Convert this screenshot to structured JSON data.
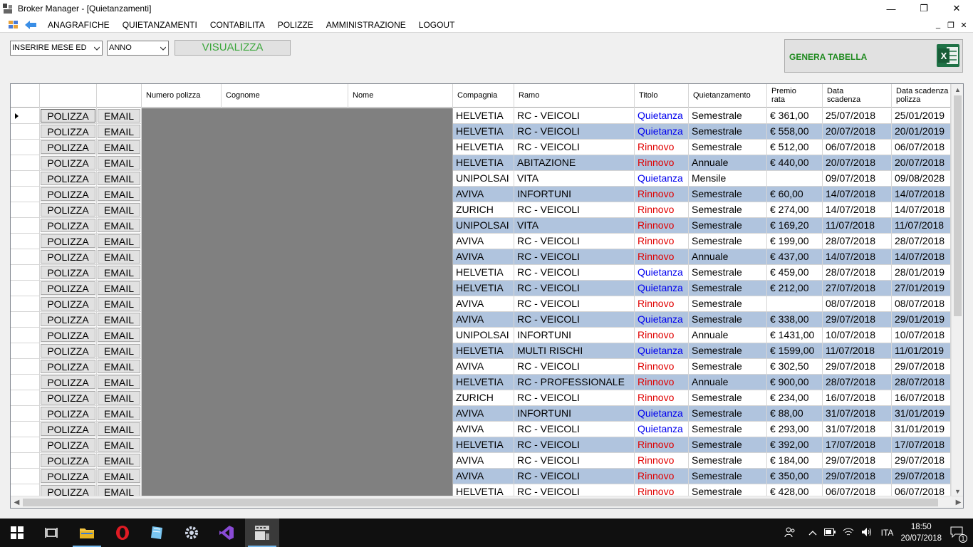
{
  "window": {
    "title": "Broker Manager - [Quietanzamenti]",
    "controls": {
      "minimize": "—",
      "maximize": "❐",
      "close": "✕"
    }
  },
  "menu": {
    "items": [
      "ANAGRAFICHE",
      "QUIETANZAMENTI",
      "CONTABILITA",
      "POLIZZE",
      "AMMINISTRAZIONE",
      "LOGOUT"
    ],
    "mdi_controls": {
      "minimize": "_",
      "restore": "❐",
      "close": "✕"
    }
  },
  "filters": {
    "month_combo": "INSERIRE MESE ED",
    "year_combo": "ANNO",
    "visualizza_label": "VISUALIZZA",
    "genera_label": "GENERA TABELLA",
    "excel_glyph": "X"
  },
  "grid": {
    "columns": {
      "numero_polizza": "Numero polizza",
      "cognome": "Cognome",
      "nome": "Nome",
      "compagnia": "Compagnia",
      "ramo": "Ramo",
      "titolo": "Titolo",
      "quietanzamento": "Quietanzamento",
      "premio_rata_1": "Premio",
      "premio_rata_2": "rata",
      "data_scadenza_1": "Data",
      "data_scadenza_2": "scadenza",
      "data_scadenza_polizza_1": "Data scadenza",
      "data_scadenza_polizza_2": "polizza"
    },
    "button_polizza": "POLIZZA",
    "button_email": "EMAIL",
    "rows": [
      {
        "compagnia": "HELVETIA",
        "ramo": "RC - VEICOLI",
        "titolo": "Quietanza",
        "quietanzamento": "Semestrale",
        "premio": "€ 361,00",
        "scadenza": "25/07/2018",
        "scadenza_polizza": "25/01/2019"
      },
      {
        "compagnia": "HELVETIA",
        "ramo": "RC - VEICOLI",
        "titolo": "Quietanza",
        "quietanzamento": "Semestrale",
        "premio": "€ 558,00",
        "scadenza": "20/07/2018",
        "scadenza_polizza": "20/01/2019"
      },
      {
        "compagnia": "HELVETIA",
        "ramo": "RC - VEICOLI",
        "titolo": "Rinnovo",
        "quietanzamento": "Semestrale",
        "premio": "€ 512,00",
        "scadenza": "06/07/2018",
        "scadenza_polizza": "06/07/2018"
      },
      {
        "compagnia": "HELVETIA",
        "ramo": "ABITAZIONE",
        "titolo": "Rinnovo",
        "quietanzamento": "Annuale",
        "premio": "€ 440,00",
        "scadenza": "20/07/2018",
        "scadenza_polizza": "20/07/2018"
      },
      {
        "compagnia": "UNIPOLSAI",
        "ramo": "VITA",
        "titolo": "Quietanza",
        "quietanzamento": "Mensile",
        "premio": "",
        "scadenza": "09/07/2018",
        "scadenza_polizza": "09/08/2028"
      },
      {
        "compagnia": "AVIVA",
        "ramo": "INFORTUNI",
        "titolo": "Rinnovo",
        "quietanzamento": "Semestrale",
        "premio": "€ 60,00",
        "scadenza": "14/07/2018",
        "scadenza_polizza": "14/07/2018"
      },
      {
        "compagnia": "ZURICH",
        "ramo": "RC - VEICOLI",
        "titolo": "Rinnovo",
        "quietanzamento": "Semestrale",
        "premio": "€ 274,00",
        "scadenza": "14/07/2018",
        "scadenza_polizza": "14/07/2018"
      },
      {
        "compagnia": "UNIPOLSAI",
        "ramo": "VITA",
        "titolo": "Rinnovo",
        "quietanzamento": "Semestrale",
        "premio": "€ 169,20",
        "scadenza": "11/07/2018",
        "scadenza_polizza": "11/07/2018"
      },
      {
        "compagnia": "AVIVA",
        "ramo": "RC - VEICOLI",
        "titolo": "Rinnovo",
        "quietanzamento": "Semestrale",
        "premio": "€ 199,00",
        "scadenza": "28/07/2018",
        "scadenza_polizza": "28/07/2018"
      },
      {
        "compagnia": "AVIVA",
        "ramo": "RC - VEICOLI",
        "titolo": "Rinnovo",
        "quietanzamento": "Annuale",
        "premio": "€ 437,00",
        "scadenza": "14/07/2018",
        "scadenza_polizza": "14/07/2018"
      },
      {
        "compagnia": "HELVETIA",
        "ramo": "RC - VEICOLI",
        "titolo": "Quietanza",
        "quietanzamento": "Semestrale",
        "premio": "€ 459,00",
        "scadenza": "28/07/2018",
        "scadenza_polizza": "28/01/2019"
      },
      {
        "compagnia": "HELVETIA",
        "ramo": "RC - VEICOLI",
        "titolo": "Quietanza",
        "quietanzamento": "Semestrale",
        "premio": "€ 212,00",
        "scadenza": "27/07/2018",
        "scadenza_polizza": "27/01/2019"
      },
      {
        "compagnia": "AVIVA",
        "ramo": "RC - VEICOLI",
        "titolo": "Rinnovo",
        "quietanzamento": "Semestrale",
        "premio": "",
        "scadenza": "08/07/2018",
        "scadenza_polizza": "08/07/2018"
      },
      {
        "compagnia": "AVIVA",
        "ramo": "RC - VEICOLI",
        "titolo": "Quietanza",
        "quietanzamento": "Semestrale",
        "premio": "€ 338,00",
        "scadenza": "29/07/2018",
        "scadenza_polizza": "29/01/2019"
      },
      {
        "compagnia": "UNIPOLSAI",
        "ramo": "INFORTUNI",
        "titolo": "Rinnovo",
        "quietanzamento": "Annuale",
        "premio": "€ 1431,00",
        "scadenza": "10/07/2018",
        "scadenza_polizza": "10/07/2018"
      },
      {
        "compagnia": "HELVETIA",
        "ramo": "MULTI RISCHI",
        "titolo": "Quietanza",
        "quietanzamento": "Semestrale",
        "premio": "€ 1599,00",
        "scadenza": "11/07/2018",
        "scadenza_polizza": "11/01/2019"
      },
      {
        "compagnia": "AVIVA",
        "ramo": "RC - VEICOLI",
        "titolo": "Rinnovo",
        "quietanzamento": "Semestrale",
        "premio": "€ 302,50",
        "scadenza": "29/07/2018",
        "scadenza_polizza": "29/07/2018"
      },
      {
        "compagnia": "HELVETIA",
        "ramo": "RC - PROFESSIONALE",
        "titolo": "Rinnovo",
        "quietanzamento": "Annuale",
        "premio": "€ 900,00",
        "scadenza": "28/07/2018",
        "scadenza_polizza": "28/07/2018"
      },
      {
        "compagnia": "ZURICH",
        "ramo": "RC - VEICOLI",
        "titolo": "Rinnovo",
        "quietanzamento": "Semestrale",
        "premio": "€ 234,00",
        "scadenza": "16/07/2018",
        "scadenza_polizza": "16/07/2018"
      },
      {
        "compagnia": "AVIVA",
        "ramo": "INFORTUNI",
        "titolo": "Quietanza",
        "quietanzamento": "Semestrale",
        "premio": "€ 88,00",
        "scadenza": "31/07/2018",
        "scadenza_polizza": "31/01/2019"
      },
      {
        "compagnia": "AVIVA",
        "ramo": "RC - VEICOLI",
        "titolo": "Quietanza",
        "quietanzamento": "Semestrale",
        "premio": "€ 293,00",
        "scadenza": "31/07/2018",
        "scadenza_polizza": "31/01/2019"
      },
      {
        "compagnia": "HELVETIA",
        "ramo": "RC - VEICOLI",
        "titolo": "Rinnovo",
        "quietanzamento": "Semestrale",
        "premio": "€ 392,00",
        "scadenza": "17/07/2018",
        "scadenza_polizza": "17/07/2018"
      },
      {
        "compagnia": "AVIVA",
        "ramo": "RC - VEICOLI",
        "titolo": "Rinnovo",
        "quietanzamento": "Semestrale",
        "premio": "€ 184,00",
        "scadenza": "29/07/2018",
        "scadenza_polizza": "29/07/2018"
      },
      {
        "compagnia": "AVIVA",
        "ramo": "RC - VEICOLI",
        "titolo": "Rinnovo",
        "quietanzamento": "Semestrale",
        "premio": "€ 350,00",
        "scadenza": "29/07/2018",
        "scadenza_polizza": "29/07/2018"
      },
      {
        "compagnia": "HELVETIA",
        "ramo": "RC - VEICOLI",
        "titolo": "Rinnovo",
        "quietanzamento": "Semestrale",
        "premio": "€ 428,00",
        "scadenza": "06/07/2018",
        "scadenza_polizza": "06/07/2018"
      }
    ],
    "colors": {
      "quietanza": "#0000ee",
      "rinnovo": "#e00000",
      "alt_row": "#b0c4de",
      "hidden_block": "#808080"
    }
  },
  "taskbar": {
    "icons": [
      "windows-start-icon",
      "task-view-icon",
      "file-explorer-icon",
      "opera-icon",
      "notepad-icon",
      "settings-gear-icon",
      "visual-studio-icon",
      "broker-manager-icon"
    ],
    "tray": {
      "language": "ITA",
      "time": "18:50",
      "date": "20/07/2018",
      "notifications": "1"
    }
  }
}
